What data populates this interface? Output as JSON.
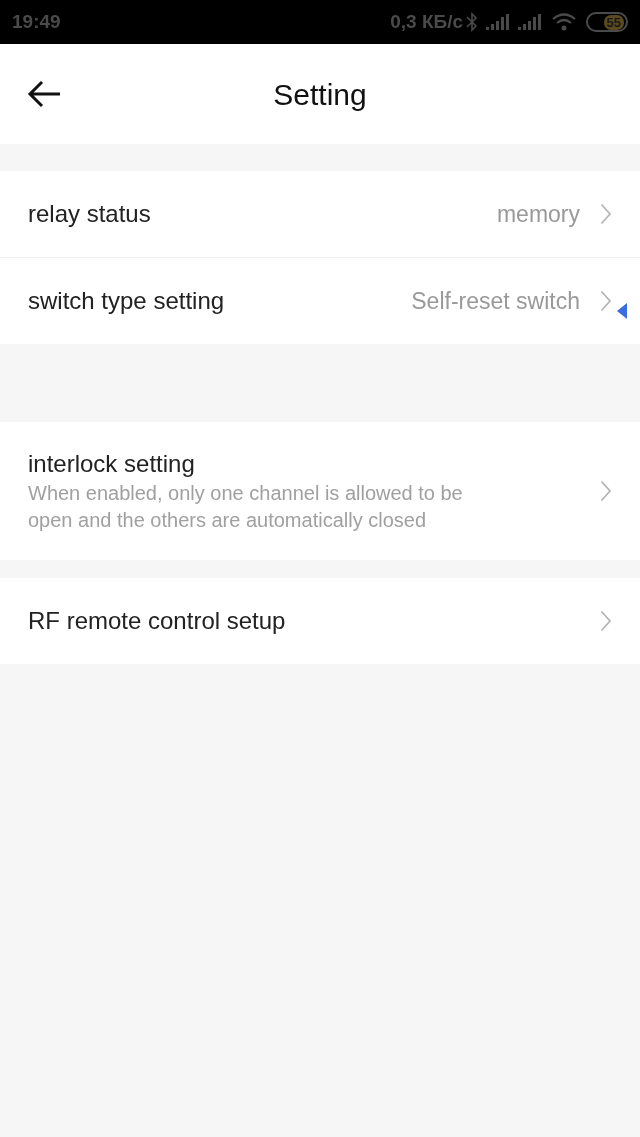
{
  "status_bar": {
    "time": "19:49",
    "net_speed": "0,3 КБ/с",
    "battery": "55"
  },
  "header": {
    "title": "Setting"
  },
  "groups": [
    {
      "items": [
        {
          "kind": "value",
          "label": "relay status",
          "value": "memory"
        },
        {
          "kind": "value",
          "label": "switch type setting",
          "value": "Self-reset switch"
        }
      ]
    },
    {
      "items": [
        {
          "kind": "description",
          "label": "interlock setting",
          "description": "When enabled, only one channel is allowed to be open and the others are automatically closed"
        }
      ]
    },
    {
      "items": [
        {
          "kind": "plain",
          "label": "RF remote control setup"
        }
      ]
    }
  ]
}
